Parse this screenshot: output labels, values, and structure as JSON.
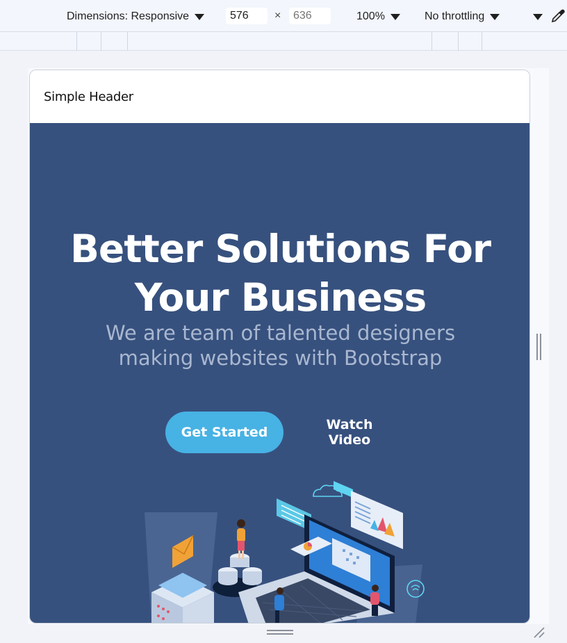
{
  "devtools": {
    "dimensions_label": "Dimensions: Responsive",
    "width_value": "576",
    "height_placeholder": "636",
    "times": "×",
    "zoom": "100%",
    "throttling": "No throttling"
  },
  "site": {
    "header_title": "Simple Header"
  },
  "hero": {
    "title": "Better Solutions For Your Business",
    "subtitle": "We are team of talented designers making websites with Bootstrap",
    "primary_button": "Get Started",
    "secondary_button": "Watch Video",
    "illustration_icon": "hero-illustration"
  },
  "colors": {
    "hero_bg": "#37517e",
    "accent": "#47b2e4",
    "subtitle": "#a9b7d0"
  }
}
